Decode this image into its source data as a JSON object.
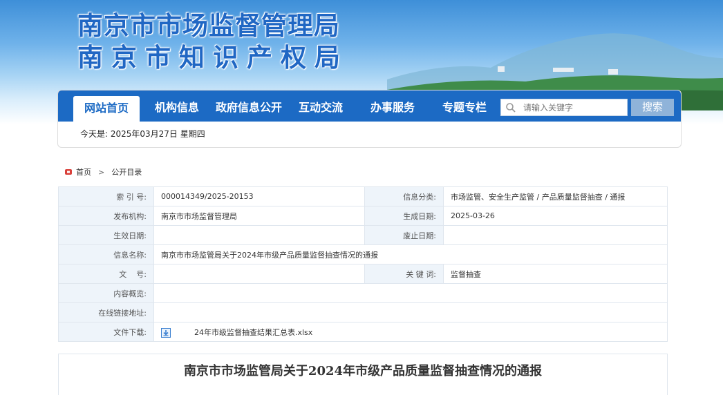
{
  "header": {
    "title_line1": "南京市市场监督管理局",
    "title_line2": "南京市知识产权局"
  },
  "nav": {
    "items": [
      "网站首页",
      "机构信息",
      "政府信息公开",
      "互动交流",
      "办事服务",
      "专题专栏"
    ],
    "active": "网站首页"
  },
  "search": {
    "placeholder": "请输入关键字",
    "button_label": "搜索"
  },
  "date_line": "今天是: 2025年03月27日 星期四",
  "breadcrumb": {
    "home": "首页",
    "separator": ">",
    "current": "公开目录"
  },
  "info_table": {
    "index_label": "索 引 号:",
    "index_value": "000014349/2025-20153",
    "category_label": "信息分类:",
    "category_value": "市场监管、安全生产监管 / 产品质量监督抽查 / 通报",
    "publisher_label": "发布机构:",
    "publisher_value": "南京市市场监督管理局",
    "created_label": "生成日期:",
    "created_value": "2025-03-26",
    "effective_label": "生效日期:",
    "effective_value": "",
    "abolished_label": "废止日期:",
    "abolished_value": "",
    "name_label": "信息名称:",
    "name_value": "南京市市场监管局关于2024年市级产品质量监督抽查情况的通报",
    "docno_label": "文    号:",
    "docno_value": "",
    "keywords_label": "关 键 词:",
    "keywords_value": "监督抽查",
    "summary_label": "内容概览:",
    "summary_value": "",
    "link_label": "在线链接地址:",
    "link_value": "",
    "download_label": "文件下载:",
    "download_file": "24年市级监督抽查结果汇总表.xlsx"
  },
  "article": {
    "title": "南京市市场监管局关于2024年市级产品质量监督抽查情况的通报"
  },
  "colors": {
    "nav_blue": "#1c6ac4",
    "title_blue": "#2067c4",
    "label_bg": "#eef4fa"
  }
}
